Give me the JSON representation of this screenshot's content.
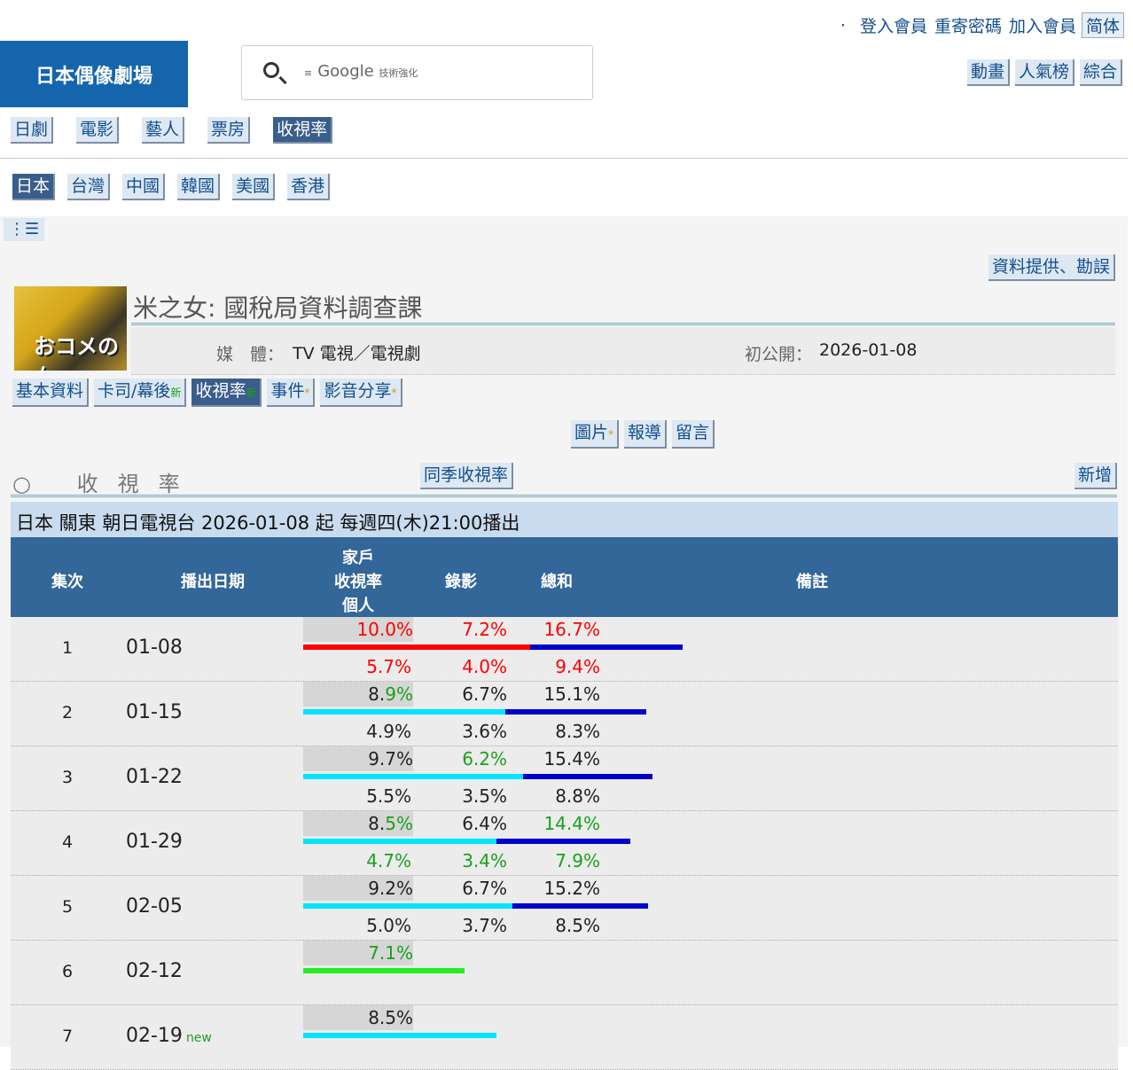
{
  "topnav": {
    "login": "登入會員",
    "resend": "重寄密碼",
    "join": "加入會員",
    "simp": "简体"
  },
  "logo": "日本偶像劇場",
  "search": {
    "brand": "Google",
    "powered": "技術強化"
  },
  "rightnav": [
    "動畫",
    "人氣榜",
    "綜合"
  ],
  "catnav": [
    "日劇",
    "電影",
    "藝人",
    "票房",
    "收視率"
  ],
  "catnav_active": "收視率",
  "regions": [
    "日本",
    "台灣",
    "中國",
    "韓國",
    "美國",
    "香港"
  ],
  "region_active": "日本",
  "menu_icon": "⋮☰",
  "report_button": "資料提供、勘誤",
  "drama": {
    "poster_text": "おコメの女",
    "title": "米之女: 國稅局資料調查課",
    "media_label": "媒　體：",
    "media": "TV 電視／電視劇",
    "premiere_label": "初公開：",
    "premiere": "2026-01-08"
  },
  "tabs": [
    {
      "label": "基本資料",
      "mark": ""
    },
    {
      "label": "卡司/幕後",
      "mark": "新"
    },
    {
      "label": "收視率",
      "mark": "新"
    },
    {
      "label": "事件",
      "mark": "*"
    },
    {
      "label": "影音分享",
      "mark": "*"
    }
  ],
  "subtabs": [
    {
      "label": "圖片",
      "mark": "*"
    },
    {
      "label": "報導",
      "mark": ""
    },
    {
      "label": "留言",
      "mark": ""
    }
  ],
  "section": {
    "title": "○ 收視率",
    "same_season": "同季收視率",
    "add": "新增"
  },
  "broadcast": "日本 關東 朝日電視台 2026-01-08 起 每週四(木)21:00播出",
  "table_header": {
    "ep": "集次",
    "date": "播出日期",
    "household": "家戶",
    "rating": "收視率",
    "personal": "個人",
    "recording": "錄影",
    "total": "總和",
    "note": "備註"
  },
  "colors": {
    "red": "#ff0000",
    "green": "#1aa11a",
    "cyan": "#00e5ff",
    "blue": "#0000cc",
    "green_bar": "#22ee22"
  },
  "episodes": [
    {
      "ep": "1",
      "date": "01-08",
      "hh": "10.0%",
      "rec": "7.2%",
      "tot": "16.7%",
      "p_hh": "5.7%",
      "p_rec": "4.0%",
      "p_tot": "9.4%",
      "hh_val": 10.0,
      "tot_val": 16.7,
      "style": "red"
    },
    {
      "ep": "2",
      "date": "01-15",
      "hh": "8.9%",
      "rec": "6.7%",
      "tot": "15.1%",
      "p_hh": "4.9%",
      "p_rec": "3.6%",
      "p_tot": "8.3%",
      "hh_val": 8.9,
      "tot_val": 15.1,
      "style": "hhgreen"
    },
    {
      "ep": "3",
      "date": "01-22",
      "hh": "9.7%",
      "rec": "6.2%",
      "tot": "15.4%",
      "p_hh": "5.5%",
      "p_rec": "3.5%",
      "p_tot": "8.8%",
      "hh_val": 9.7,
      "tot_val": 15.4,
      "style": "recgreen"
    },
    {
      "ep": "4",
      "date": "01-29",
      "hh": "8.5%",
      "rec": "6.4%",
      "tot": "14.4%",
      "p_hh": "4.7%",
      "p_rec": "3.4%",
      "p_tot": "7.9%",
      "hh_val": 8.5,
      "tot_val": 14.4,
      "style": "low"
    },
    {
      "ep": "5",
      "date": "02-05",
      "hh": "9.2%",
      "rec": "6.7%",
      "tot": "15.2%",
      "p_hh": "5.0%",
      "p_rec": "3.7%",
      "p_tot": "8.5%",
      "hh_val": 9.2,
      "tot_val": 15.2,
      "style": "normal"
    },
    {
      "ep": "6",
      "date": "02-12",
      "hh": "7.1%",
      "rec": "",
      "tot": "",
      "p_hh": "",
      "p_rec": "",
      "p_tot": "",
      "hh_val": 7.1,
      "tot_val": 0,
      "style": "min"
    },
    {
      "ep": "7",
      "date": "02-19",
      "new": "new",
      "hh": "8.5%",
      "rec": "",
      "tot": "",
      "p_hh": "",
      "p_rec": "",
      "p_tot": "",
      "hh_val": 8.5,
      "tot_val": 0,
      "style": "normal"
    }
  ]
}
